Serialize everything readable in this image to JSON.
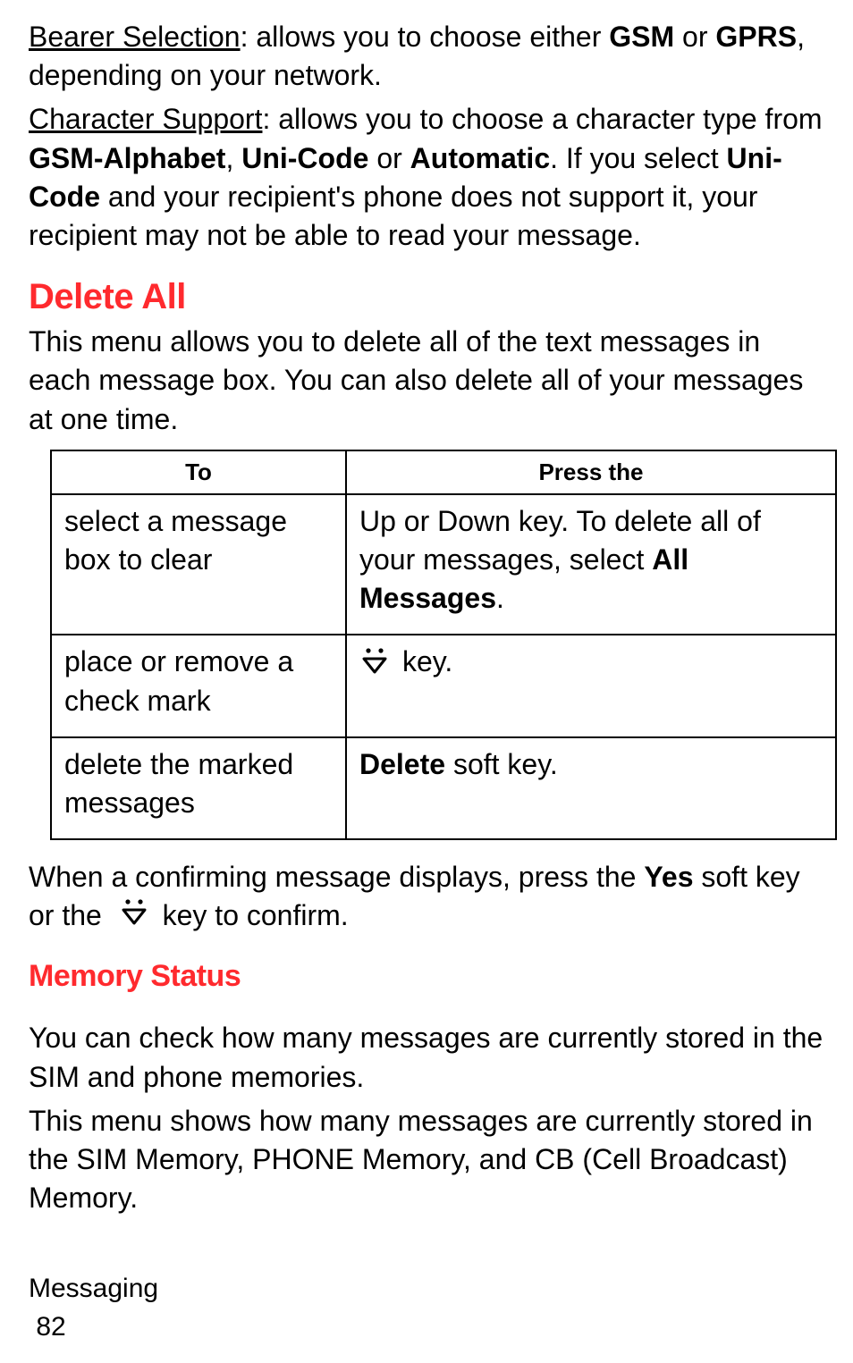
{
  "para1": {
    "bearer_label": "Bearer Selection",
    "text1": ": allows you to choose either ",
    "gsm": "GSM",
    "text2": " or ",
    "gprs": "GPRS",
    "text3": ", depending on your network."
  },
  "para2": {
    "char_label": "Character Support",
    "text1": ": allows you to choose a character type from ",
    "gsm_alpha": "GSM-Alphabet",
    "comma1": ", ",
    "unicode": "Uni-Code",
    "text_or": " or ",
    "automatic": "Automatic",
    "text2": ". If you select ",
    "unicode2": "Uni-Code",
    "text3": " and your recipient's phone does not support it, your recipient may not be able to read your message."
  },
  "delete_all_heading": "Delete All",
  "delete_all_intro": "This menu allows you to delete all of the text messages in each message box. You can also delete all of your messages at one time.",
  "table": {
    "head_to": "To",
    "head_press": "Press the",
    "r1c1": "select a message box to clear",
    "r1c2a": "Up or Down key. To delete all of your messages, select ",
    "r1c2b": "All Messages",
    "r1c2c": ".",
    "r2c1": "place or remove a check mark",
    "r2c2_after": " key.",
    "r3c1": "delete the marked messages",
    "r3c2a": "Delete",
    "r3c2b": " soft key."
  },
  "confirm": {
    "t1": "When a confirming message displays, press the ",
    "yes": "Yes",
    "t2": " soft key or the ",
    "t3": " key to confirm."
  },
  "memory_status_heading": "Memory Status",
  "mem_p1": "You can check how many messages are currently stored in the SIM and phone memories.",
  "mem_p2": "This menu shows how many messages are currently stored in the SIM Memory, PHONE Memory, and CB (Cell Broadcast) Memory.",
  "footer_section": "Messaging",
  "page_number": "82"
}
